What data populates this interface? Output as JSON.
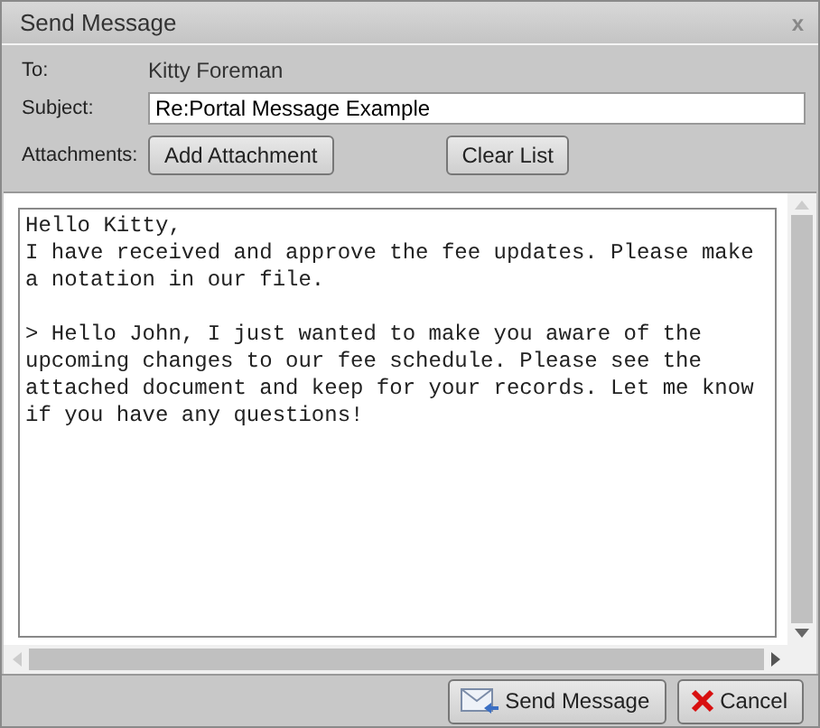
{
  "window": {
    "title": "Send Message",
    "close": "x"
  },
  "to": {
    "label": "To:",
    "value": "Kitty Foreman"
  },
  "subject": {
    "label": "Subject:",
    "value": "Re:Portal Message Example"
  },
  "attachments": {
    "label": "Attachments:",
    "buttons": [
      "Add Attachment",
      "Clear List"
    ]
  },
  "message": {
    "body": "Hello Kitty,\nI have received and approve the fee updates. Please make a notation in our file.\n\n> Hello John, I just wanted to make you aware of the upcoming changes to our fee schedule. Please see the attached document and keep for your records. Let me know if you have any questions!"
  },
  "buttons": [
    {
      "kind": "send",
      "label": "Send Message"
    },
    {
      "kind": "cancel",
      "label": "Cancel"
    }
  ]
}
